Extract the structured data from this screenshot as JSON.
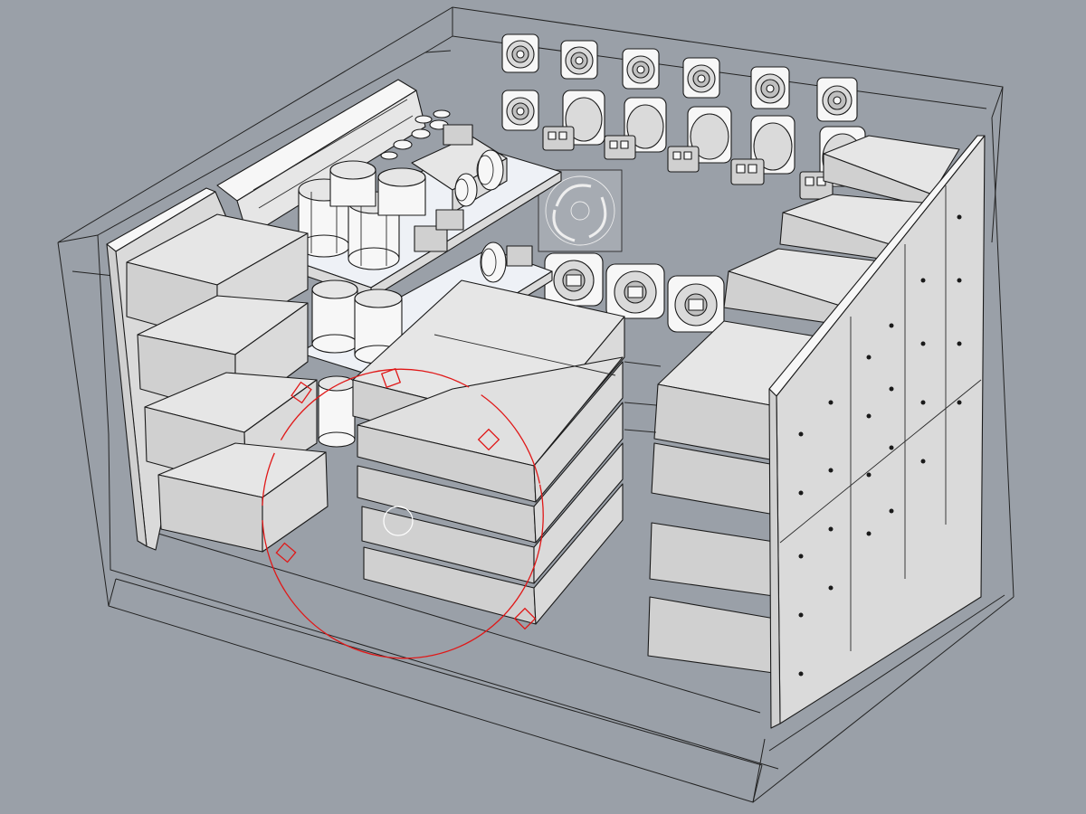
{
  "viewport": {
    "type": "shaded-3d-perspective",
    "background": "#9aa0a8",
    "gizmo_color": "#e01818"
  },
  "scene": {
    "objects": [
      "enclosure-wireframe",
      "left-battery-stack",
      "center-battery-stack",
      "right-battery-stack",
      "right-mounting-panel",
      "back-wall-connectors",
      "amplifier-boards",
      "fan-grill",
      "rotation-gizmo"
    ],
    "back_connector_top_row_count": 6,
    "back_connector_second_row_count": 6,
    "lower_connector_count": 3
  }
}
